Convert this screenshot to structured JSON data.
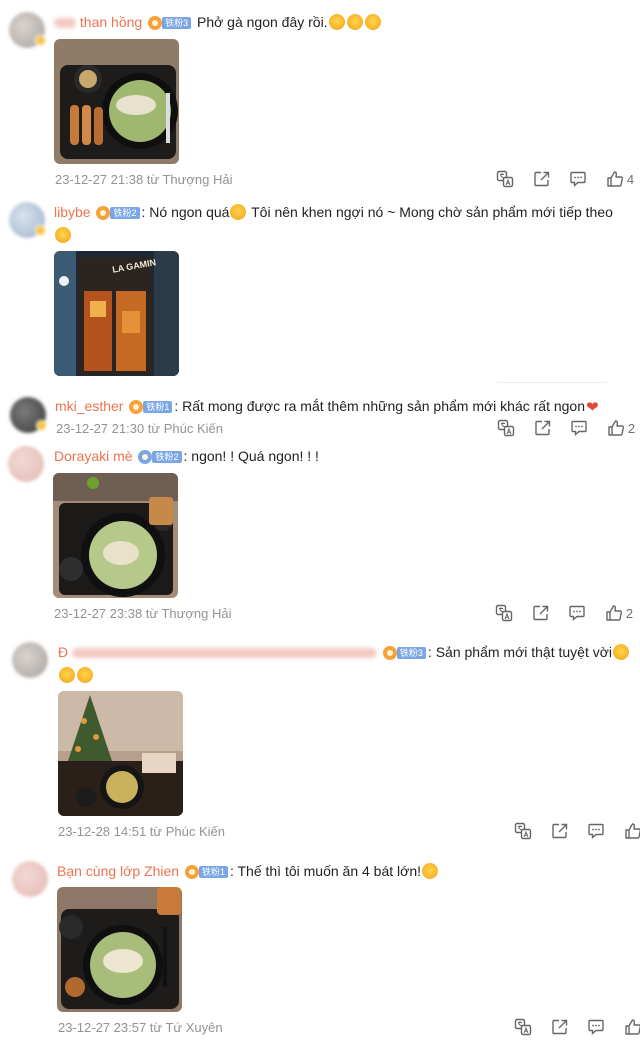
{
  "comments": [
    {
      "username": "than hồng",
      "badge_level": "铁粉3",
      "text": "Phở gà ngon đây rồi.",
      "timestamp": "23-12-27 21:38 từ Thượng Hải",
      "likes": "4"
    },
    {
      "username": "libybe",
      "badge_level": "铁粉2",
      "text": ": Nó ngon quá",
      "text2": " Tôi nên khen ngợi nó ~ Mong chờ sản phẩm mới tiếp theo",
      "image_sign_text": "LA GAMIN"
    },
    {
      "username": "mki_esther",
      "badge_level": "铁粉1",
      "text": ": Rất mong được ra mắt thêm những sản phẩm mới khác rất ngon",
      "timestamp": "23-12-27 21:30 từ Phúc Kiến",
      "likes": "2"
    },
    {
      "username": "Dorayaki mè",
      "badge_level": "铁粉2",
      "text": ": ngon! ! Quá ngon! ! !",
      "timestamp": "23-12-27 23:38 từ Thượng Hải",
      "likes": "2"
    },
    {
      "username": "Đ",
      "badge_level": "铁粉3",
      "text": ": Sản phẩm mới thật tuyệt vời",
      "timestamp": "23-12-28 14:51 từ Phúc Kiến",
      "likes": ""
    },
    {
      "username": "Bạn cùng lớp Zhien",
      "badge_level": "铁粉1",
      "text": ": Thế thì tôi muốn ăn 4 bát lớn!",
      "timestamp": "23-12-27 23:57 từ Tứ Xuyên",
      "likes": ""
    }
  ],
  "colors": {
    "username": "#eb7350",
    "meta": "#939393",
    "badge": "#7aa6e6"
  },
  "icons": [
    "translate-icon",
    "share-icon",
    "comment-icon",
    "like-icon"
  ]
}
